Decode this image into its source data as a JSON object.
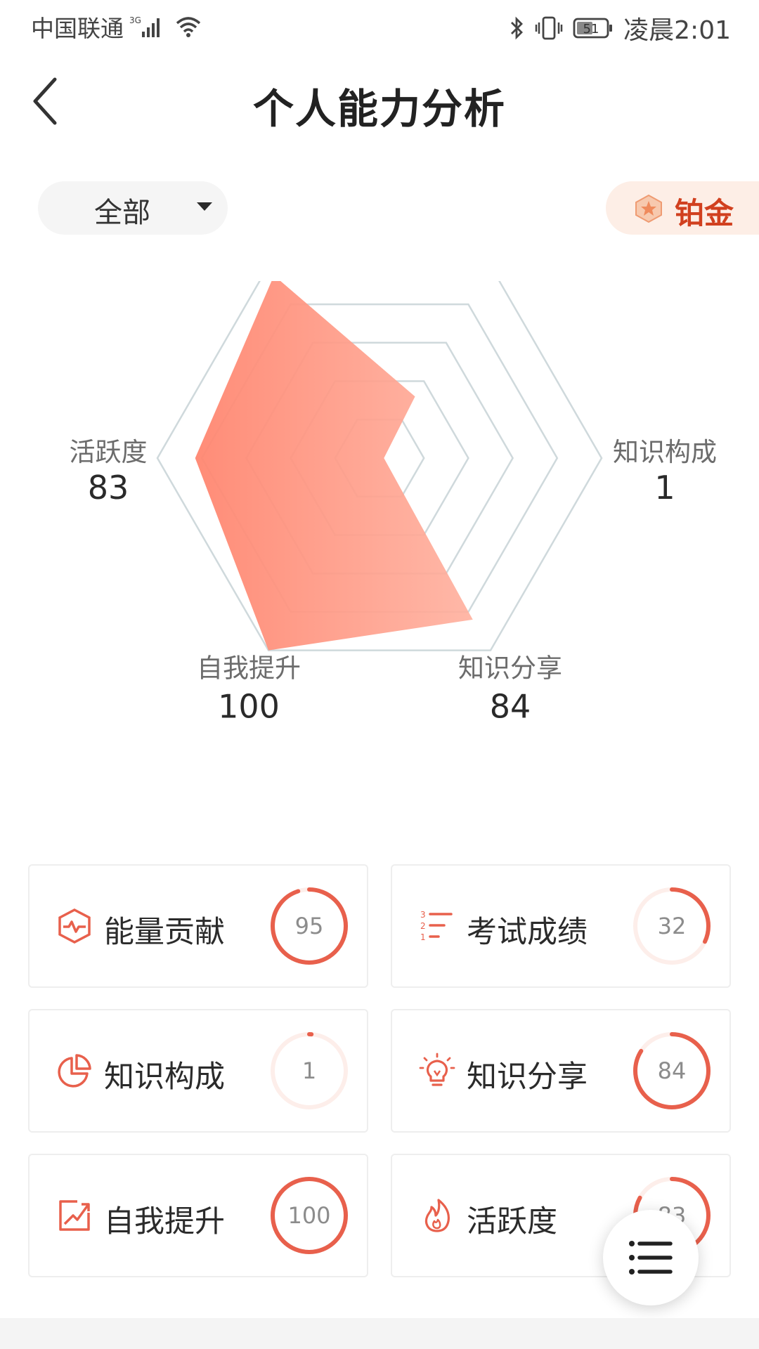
{
  "status_bar": {
    "carrier": "中国联通",
    "network": "3G",
    "battery": "51",
    "time": "凌晨2:01"
  },
  "header": {
    "title": "个人能力分析",
    "back_icon": "chevron-left-icon"
  },
  "filter": {
    "selected": "全部",
    "icon": "caret-down-icon"
  },
  "level_badge": {
    "label": "铂金",
    "icon": "badge-star-icon",
    "color": "#d1401f"
  },
  "chart_data": {
    "type": "radar",
    "max": 100,
    "categories": [
      "能量贡献",
      "考试成绩",
      "知识构成",
      "知识分享",
      "自我提升",
      "活跃度"
    ],
    "values": [
      95,
      32,
      1,
      84,
      100,
      83
    ],
    "grid_levels": 5,
    "fill_color": "#ff8a75",
    "grid_color": "#cfd9dc"
  },
  "cards": [
    {
      "label": "能量贡献",
      "value": "95",
      "icon": "hexagon-pulse-icon"
    },
    {
      "label": "考试成绩",
      "value": "32",
      "icon": "ranked-list-icon"
    },
    {
      "label": "知识构成",
      "value": "1",
      "icon": "pie-chart-icon"
    },
    {
      "label": "知识分享",
      "value": "84",
      "icon": "lightbulb-icon"
    },
    {
      "label": "自我提升",
      "value": "100",
      "icon": "trend-up-icon"
    },
    {
      "label": "活跃度",
      "value": "83",
      "icon": "flame-icon"
    }
  ],
  "accent_color": "#e8604c",
  "fab": {
    "icon": "menu-list-icon"
  }
}
